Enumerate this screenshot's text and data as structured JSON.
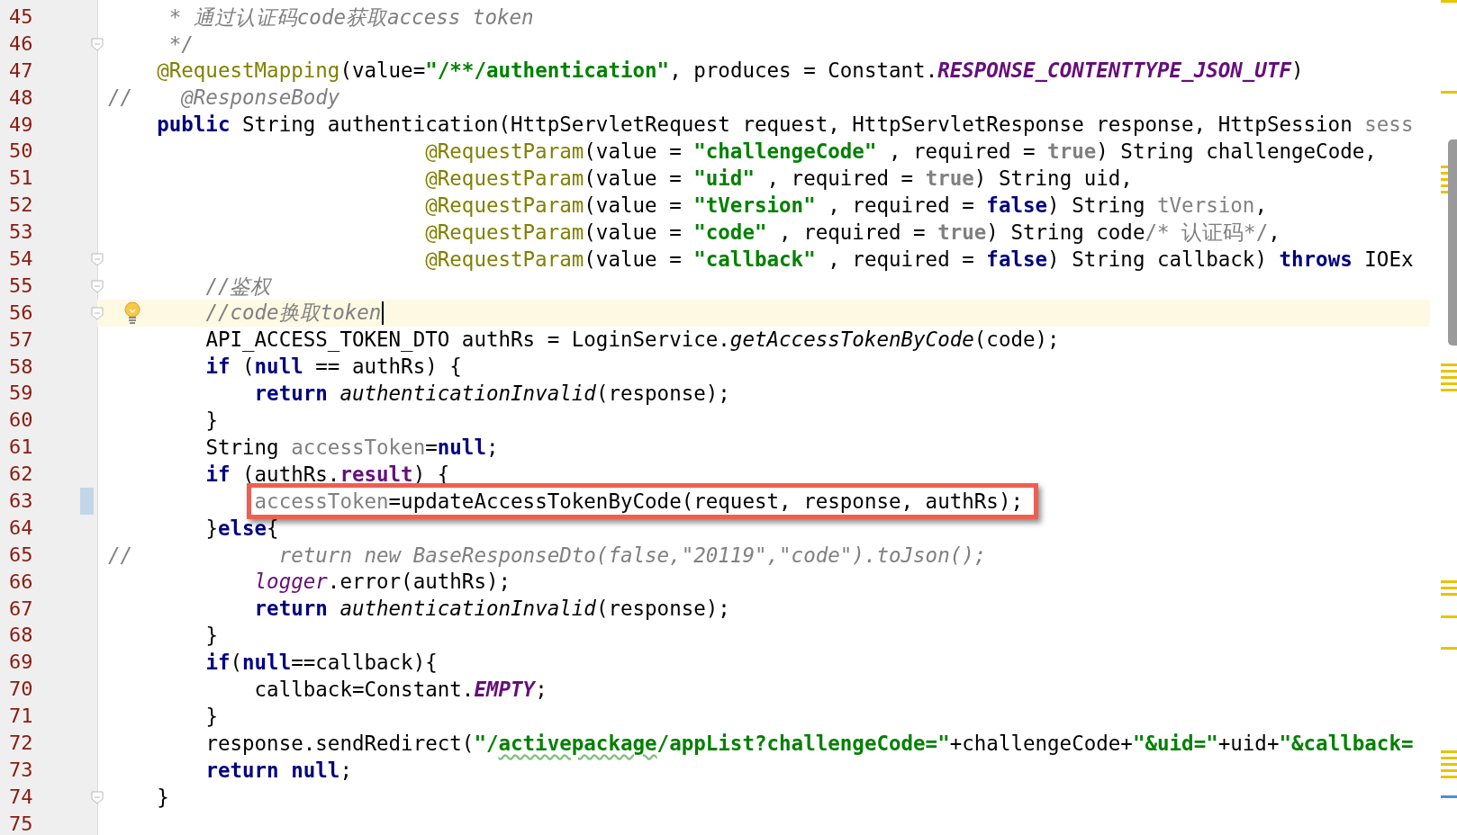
{
  "editor": {
    "lines": [
      {
        "number": "45",
        "current": false,
        "boxed": false,
        "fold_marker": false,
        "modified": false,
        "tokens": [
          {
            "kind": "javadoc",
            "text": "     * 通过认证码code获取access token"
          }
        ]
      },
      {
        "number": "46",
        "current": false,
        "boxed": false,
        "fold_marker": true,
        "modified": false,
        "tokens": [
          {
            "kind": "javadoc",
            "text": "     */"
          }
        ]
      },
      {
        "number": "47",
        "current": false,
        "boxed": false,
        "fold_marker": false,
        "modified": false,
        "tokens": [
          {
            "kind": "annotation",
            "text": "    @RequestMapping"
          },
          {
            "kind": "plain",
            "text": "(value="
          },
          {
            "kind": "string",
            "text": "\"/**/authentication\""
          },
          {
            "kind": "plain",
            "text": ", produces = Constant."
          },
          {
            "kind": "static_field",
            "text": "RESPONSE_CONTENTTYPE_JSON_UTF"
          },
          {
            "kind": "plain",
            "text": ")"
          }
        ]
      },
      {
        "number": "48",
        "current": false,
        "boxed": false,
        "fold_marker": false,
        "modified": false,
        "tokens": [
          {
            "kind": "comment",
            "text": "//    @ResponseBody"
          }
        ]
      },
      {
        "number": "49",
        "current": false,
        "boxed": false,
        "fold_marker": false,
        "modified": false,
        "tokens": [
          {
            "kind": "keyword",
            "text": "    public"
          },
          {
            "kind": "plain",
            "text": " String authentication(HttpServletRequest request, HttpServletResponse response, HttpSession "
          },
          {
            "kind": "unused",
            "text": "sess"
          }
        ]
      },
      {
        "number": "50",
        "current": false,
        "boxed": false,
        "fold_marker": false,
        "modified": false,
        "tokens": [
          {
            "kind": "annotation",
            "text": "                          @RequestParam"
          },
          {
            "kind": "plain",
            "text": "(value = "
          },
          {
            "kind": "string",
            "text": "\"challengeCode\""
          },
          {
            "kind": "plain",
            "text": " , required = "
          },
          {
            "kind": "dim_keyword",
            "text": "true"
          },
          {
            "kind": "plain",
            "text": ") String challengeCode,"
          }
        ]
      },
      {
        "number": "51",
        "current": false,
        "boxed": false,
        "fold_marker": false,
        "modified": false,
        "tokens": [
          {
            "kind": "annotation",
            "text": "                          @RequestParam"
          },
          {
            "kind": "plain",
            "text": "(value = "
          },
          {
            "kind": "string",
            "text": "\"uid\""
          },
          {
            "kind": "plain",
            "text": " , required = "
          },
          {
            "kind": "dim_keyword",
            "text": "true"
          },
          {
            "kind": "plain",
            "text": ") String uid,"
          }
        ]
      },
      {
        "number": "52",
        "current": false,
        "boxed": false,
        "fold_marker": false,
        "modified": false,
        "tokens": [
          {
            "kind": "annotation",
            "text": "                          @RequestParam"
          },
          {
            "kind": "plain",
            "text": "(value = "
          },
          {
            "kind": "string",
            "text": "\"tVersion\""
          },
          {
            "kind": "plain",
            "text": " , required = "
          },
          {
            "kind": "keyword",
            "text": "false"
          },
          {
            "kind": "plain",
            "text": ") String "
          },
          {
            "kind": "unused",
            "text": "tVersion"
          },
          {
            "kind": "plain",
            "text": ","
          }
        ]
      },
      {
        "number": "53",
        "current": false,
        "boxed": false,
        "fold_marker": false,
        "modified": false,
        "tokens": [
          {
            "kind": "annotation",
            "text": "                          @RequestParam"
          },
          {
            "kind": "plain",
            "text": "(value = "
          },
          {
            "kind": "string",
            "text": "\"code\""
          },
          {
            "kind": "plain",
            "text": " , required = "
          },
          {
            "kind": "dim_keyword",
            "text": "true"
          },
          {
            "kind": "plain",
            "text": ") String code"
          },
          {
            "kind": "block_comment",
            "text": "/* 认证码*/"
          },
          {
            "kind": "plain",
            "text": ","
          }
        ]
      },
      {
        "number": "54",
        "current": false,
        "boxed": false,
        "fold_marker": true,
        "modified": false,
        "tokens": [
          {
            "kind": "annotation",
            "text": "                          @RequestParam"
          },
          {
            "kind": "plain",
            "text": "(value = "
          },
          {
            "kind": "string",
            "text": "\"callback\""
          },
          {
            "kind": "plain",
            "text": " , required = "
          },
          {
            "kind": "keyword",
            "text": "false"
          },
          {
            "kind": "plain",
            "text": ") String callback) "
          },
          {
            "kind": "keyword",
            "text": "throws"
          },
          {
            "kind": "plain",
            "text": " IOEx"
          }
        ]
      },
      {
        "number": "55",
        "current": false,
        "boxed": false,
        "fold_marker": true,
        "modified": false,
        "tokens": [
          {
            "kind": "comment",
            "text": "        //鉴权"
          }
        ]
      },
      {
        "number": "56",
        "current": true,
        "boxed": false,
        "fold_marker": true,
        "modified": false,
        "tokens": [
          {
            "kind": "comment",
            "text": "        //code换取token"
          }
        ]
      },
      {
        "number": "57",
        "current": false,
        "boxed": false,
        "fold_marker": false,
        "modified": false,
        "tokens": [
          {
            "kind": "plain",
            "text": "        API_ACCESS_TOKEN_DTO authRs = LoginService."
          },
          {
            "kind": "static_method",
            "text": "getAccessTokenByCode"
          },
          {
            "kind": "plain",
            "text": "(code);"
          }
        ]
      },
      {
        "number": "58",
        "current": false,
        "boxed": false,
        "fold_marker": false,
        "modified": false,
        "tokens": [
          {
            "kind": "keyword",
            "text": "        if"
          },
          {
            "kind": "plain",
            "text": " ("
          },
          {
            "kind": "keyword",
            "text": "null"
          },
          {
            "kind": "plain",
            "text": " == authRs) {"
          }
        ]
      },
      {
        "number": "59",
        "current": false,
        "boxed": false,
        "fold_marker": false,
        "modified": false,
        "tokens": [
          {
            "kind": "keyword",
            "text": "            return "
          },
          {
            "kind": "static_method",
            "text": "authenticationInvalid"
          },
          {
            "kind": "plain",
            "text": "(response);"
          }
        ]
      },
      {
        "number": "60",
        "current": false,
        "boxed": false,
        "fold_marker": false,
        "modified": false,
        "tokens": [
          {
            "kind": "plain",
            "text": "        }"
          }
        ]
      },
      {
        "number": "61",
        "current": false,
        "boxed": false,
        "fold_marker": false,
        "modified": false,
        "tokens": [
          {
            "kind": "plain",
            "text": "        String "
          },
          {
            "kind": "unused",
            "text": "accessToken"
          },
          {
            "kind": "plain",
            "text": "="
          },
          {
            "kind": "keyword",
            "text": "null"
          },
          {
            "kind": "plain",
            "text": ";"
          }
        ]
      },
      {
        "number": "62",
        "current": false,
        "boxed": false,
        "fold_marker": false,
        "modified": false,
        "tokens": [
          {
            "kind": "keyword",
            "text": "        if"
          },
          {
            "kind": "plain",
            "text": " (authRs."
          },
          {
            "kind": "field",
            "text": "result"
          },
          {
            "kind": "plain",
            "text": ") {"
          }
        ]
      },
      {
        "number": "63",
        "current": false,
        "boxed": true,
        "fold_marker": false,
        "modified": true,
        "tokens": [
          {
            "kind": "unused",
            "text": "            accessToken"
          },
          {
            "kind": "plain",
            "text": "=updateAccessTokenByCode(request, response, authRs);"
          }
        ]
      },
      {
        "number": "64",
        "current": false,
        "boxed": false,
        "fold_marker": false,
        "modified": false,
        "tokens": [
          {
            "kind": "plain",
            "text": "        }"
          },
          {
            "kind": "keyword",
            "text": "else"
          },
          {
            "kind": "plain",
            "text": "{"
          }
        ]
      },
      {
        "number": "65",
        "current": false,
        "boxed": false,
        "fold_marker": false,
        "modified": false,
        "tokens": [
          {
            "kind": "comment",
            "text": "//            return new BaseResponseDto(false,\"20119\",\"code\").toJson();"
          }
        ]
      },
      {
        "number": "66",
        "current": false,
        "boxed": false,
        "fold_marker": false,
        "modified": false,
        "tokens": [
          {
            "kind": "static_var",
            "text": "            logger"
          },
          {
            "kind": "plain",
            "text": ".error(authRs);"
          }
        ]
      },
      {
        "number": "67",
        "current": false,
        "boxed": false,
        "fold_marker": false,
        "modified": false,
        "tokens": [
          {
            "kind": "keyword",
            "text": "            return "
          },
          {
            "kind": "static_method",
            "text": "authenticationInvalid"
          },
          {
            "kind": "plain",
            "text": "(response);"
          }
        ]
      },
      {
        "number": "68",
        "current": false,
        "boxed": false,
        "fold_marker": false,
        "modified": false,
        "tokens": [
          {
            "kind": "plain",
            "text": "        }"
          }
        ]
      },
      {
        "number": "69",
        "current": false,
        "boxed": false,
        "fold_marker": false,
        "modified": false,
        "tokens": [
          {
            "kind": "keyword",
            "text": "        if"
          },
          {
            "kind": "plain",
            "text": "("
          },
          {
            "kind": "keyword",
            "text": "null"
          },
          {
            "kind": "plain",
            "text": "==callback){"
          }
        ]
      },
      {
        "number": "70",
        "current": false,
        "boxed": false,
        "fold_marker": false,
        "modified": false,
        "tokens": [
          {
            "kind": "plain",
            "text": "            callback=Constant."
          },
          {
            "kind": "static_field",
            "text": "EMPTY"
          },
          {
            "kind": "plain",
            "text": ";"
          }
        ]
      },
      {
        "number": "71",
        "current": false,
        "boxed": false,
        "fold_marker": false,
        "modified": false,
        "tokens": [
          {
            "kind": "plain",
            "text": "        }"
          }
        ]
      },
      {
        "number": "72",
        "current": false,
        "boxed": false,
        "fold_marker": false,
        "modified": false,
        "tokens": [
          {
            "kind": "plain",
            "text": "        response.sendRedirect("
          },
          {
            "kind": "string",
            "text": "\"/"
          },
          {
            "kind": "string_typo",
            "text": "activepackage"
          },
          {
            "kind": "string",
            "text": "/appList?challengeCode=\""
          },
          {
            "kind": "plain",
            "text": "+challengeCode+"
          },
          {
            "kind": "string",
            "text": "\"&uid=\""
          },
          {
            "kind": "plain",
            "text": "+uid+"
          },
          {
            "kind": "string",
            "text": "\"&callback="
          }
        ]
      },
      {
        "number": "73",
        "current": false,
        "boxed": false,
        "fold_marker": false,
        "modified": false,
        "tokens": [
          {
            "kind": "keyword",
            "text": "        return null"
          },
          {
            "kind": "plain",
            "text": ";"
          }
        ]
      },
      {
        "number": "74",
        "current": false,
        "boxed": false,
        "fold_marker": true,
        "modified": false,
        "tokens": [
          {
            "kind": "plain",
            "text": "    }"
          }
        ]
      },
      {
        "number": "75",
        "current": false,
        "boxed": false,
        "fold_marker": false,
        "modified": false
      }
    ]
  }
}
